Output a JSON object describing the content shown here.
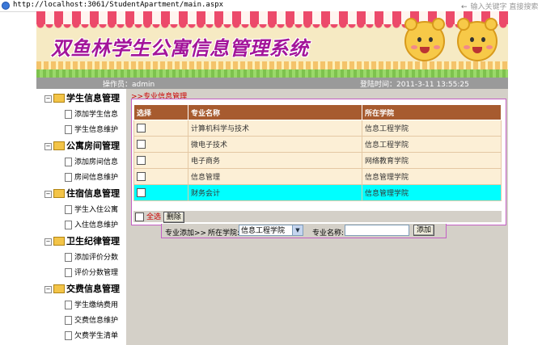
{
  "browser": {
    "url": "http://localhost:3061/StudentApartment/main.aspx",
    "search_hint": "输入关键字 直接搜索"
  },
  "banner": {
    "title": "双鱼林学生公寓信息管理系统"
  },
  "status_bar": {
    "operator": "操作员：admin",
    "login_time": "登陆时间：2011-3-11 13:55:25"
  },
  "sidebar": {
    "groups": [
      {
        "title": "学生信息管理",
        "items": [
          "添加学生信息",
          "学生信息维护"
        ]
      },
      {
        "title": "公寓房间管理",
        "items": [
          "添加房间信息",
          "房间信息维护"
        ]
      },
      {
        "title": "住宿信息管理",
        "items": [
          "学生入住公寓",
          "入住信息维护"
        ]
      },
      {
        "title": "卫生纪律管理",
        "items": [
          "添加评价分数",
          "评价分数管理"
        ]
      },
      {
        "title": "交费信息管理",
        "items": [
          "学生缴纳费用",
          "交费信息维护",
          "欠费学生清单"
        ]
      }
    ]
  },
  "main": {
    "breadcrumb": ">>专业信息管理",
    "table": {
      "headers": [
        "选择",
        "专业名称",
        "所在学院"
      ],
      "rows": [
        {
          "name": "计算机科学与技术",
          "college": "信息工程学院"
        },
        {
          "name": "微电子技术",
          "college": "信息工程学院"
        },
        {
          "name": "电子商务",
          "college": "网络教育学院"
        },
        {
          "name": "信息管理",
          "college": "信息管理学院"
        },
        {
          "name": "财务会计",
          "college": "信息管理学院"
        }
      ]
    },
    "select_all_label": "全选",
    "delete_label": "删除",
    "add_form": {
      "title": "专业添加>>",
      "college_label": "所在学院:",
      "college_selected": "信息工程学院",
      "name_label": "专业名称:",
      "name_value": "",
      "add_label": "添加"
    }
  },
  "colors": {
    "header_bg": "#a75b2f",
    "row_bg": "#fcefd6",
    "highlight_row": "#00ffff",
    "title_color": "#a3159a",
    "panel_border": "#c45fc4"
  }
}
